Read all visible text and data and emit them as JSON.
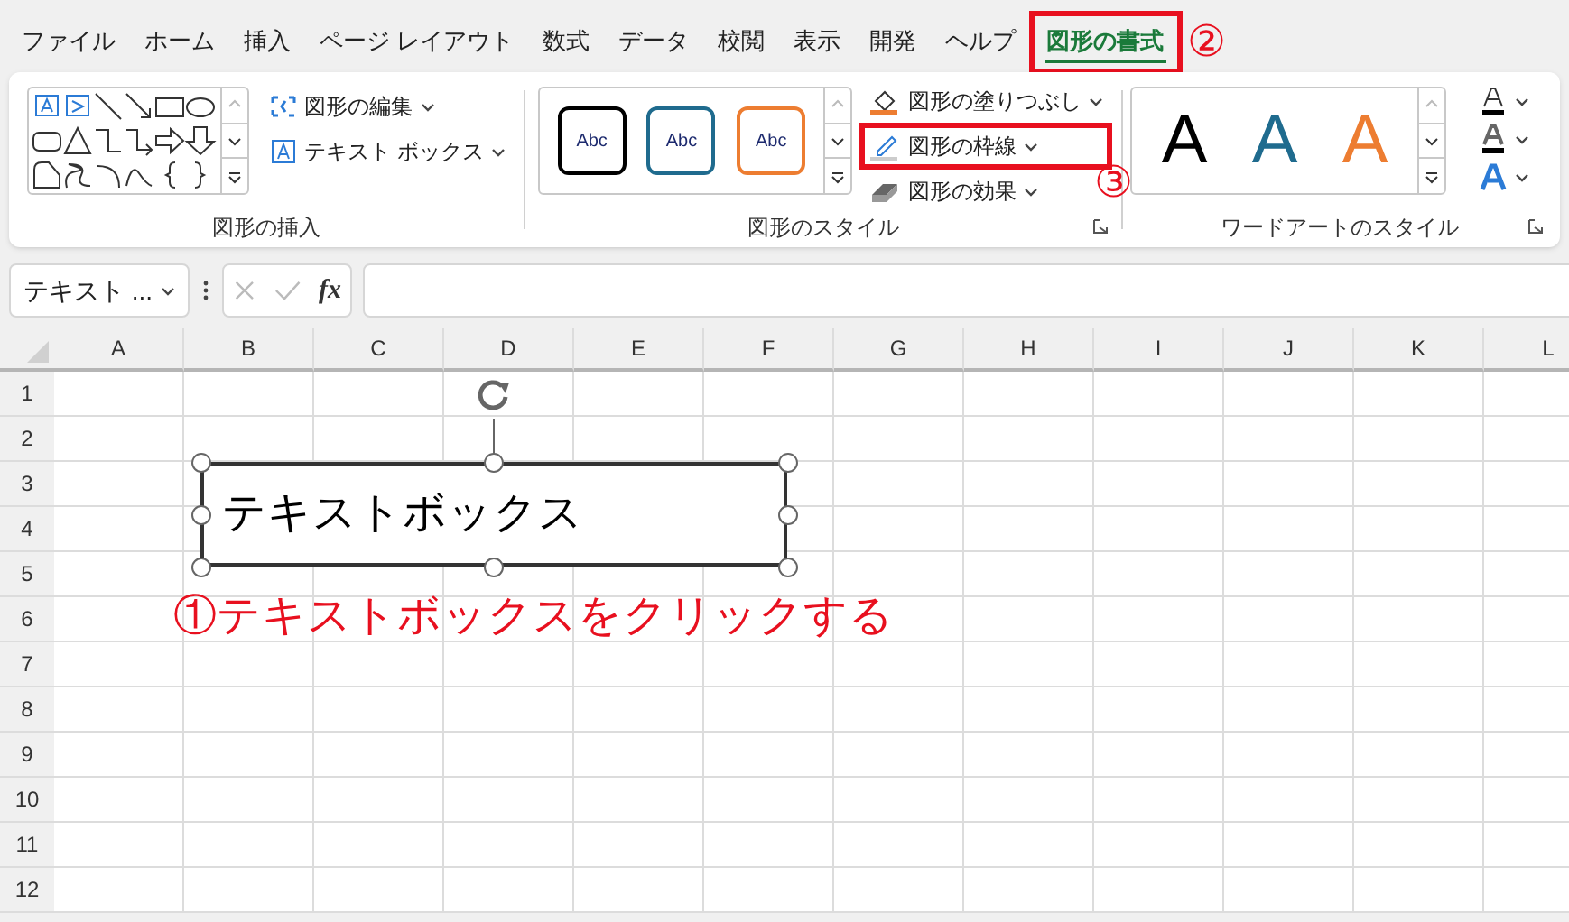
{
  "tabs": [
    {
      "label": "ファイル",
      "selected": false,
      "highlighted": false
    },
    {
      "label": "ホーム",
      "selected": false,
      "highlighted": false
    },
    {
      "label": "挿入",
      "selected": false,
      "highlighted": false
    },
    {
      "label": "ページ レイアウト",
      "selected": false,
      "highlighted": false
    },
    {
      "label": "数式",
      "selected": false,
      "highlighted": false
    },
    {
      "label": "データ",
      "selected": false,
      "highlighted": false
    },
    {
      "label": "校閲",
      "selected": false,
      "highlighted": false
    },
    {
      "label": "表示",
      "selected": false,
      "highlighted": false
    },
    {
      "label": "開発",
      "selected": false,
      "highlighted": false
    },
    {
      "label": "ヘルプ",
      "selected": false,
      "highlighted": false
    },
    {
      "label": "図形の書式",
      "selected": true,
      "highlighted": true
    }
  ],
  "ribbon": {
    "groups": [
      {
        "label": "図形の挿入",
        "buttons": [
          {
            "label": "図形の編集",
            "highlighted": false
          },
          {
            "label": "テキスト ボックス",
            "highlighted": false
          }
        ]
      },
      {
        "label": "図形のスタイル",
        "style_presets": [
          {
            "label": "Abc",
            "color": "#000000"
          },
          {
            "label": "Abc",
            "color": "#1f6b8e"
          },
          {
            "label": "Abc",
            "color": "#ed7d31"
          }
        ],
        "buttons": [
          {
            "label": "図形の塗りつぶし",
            "highlighted": false
          },
          {
            "label": "図形の枠線",
            "highlighted": true
          },
          {
            "label": "図形の効果",
            "highlighted": false
          }
        ]
      },
      {
        "label": "ワードアートのスタイル",
        "wordart_presets": [
          {
            "label": "A",
            "color": "#000000"
          },
          {
            "label": "A",
            "color": "#1f6b8e"
          },
          {
            "label": "A",
            "color": "#ed7d31"
          }
        ]
      }
    ]
  },
  "formula_bar": {
    "name_box": "テキスト ...",
    "function_label": "fx"
  },
  "columns": [
    "A",
    "B",
    "C",
    "D",
    "E",
    "F",
    "G",
    "H",
    "I",
    "J",
    "K",
    "L"
  ],
  "rows": [
    "1",
    "2",
    "3",
    "4",
    "5",
    "6",
    "7",
    "8",
    "9",
    "10",
    "11",
    "12"
  ],
  "text_box": {
    "text": "テキストボックス"
  },
  "annotations": [
    {
      "text": "①テキストボックスをクリックする"
    },
    {
      "text": "②"
    },
    {
      "text": "③"
    }
  ]
}
